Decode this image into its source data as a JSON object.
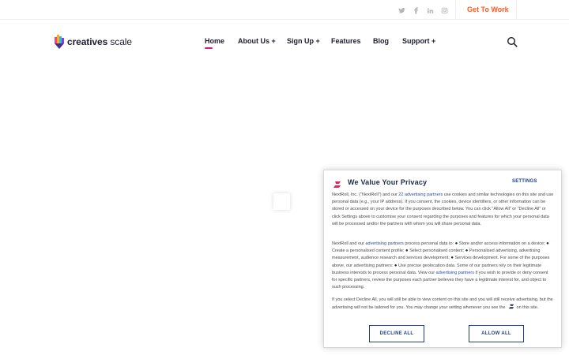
{
  "topbar": {
    "social_icons": [
      "twitter-icon",
      "facebook-icon",
      "linkedin-icon",
      "instagram-icon"
    ],
    "cta_label": "Get To Work"
  },
  "header": {
    "logo_text_bold": "creatives",
    "logo_text_light": "scale",
    "nav": [
      {
        "label": "Home"
      },
      {
        "label": "About Us +"
      },
      {
        "label": "Sign Up +"
      },
      {
        "label": "Features"
      },
      {
        "label": "Blog"
      },
      {
        "label": "Support +"
      }
    ],
    "search_icon": "search-icon"
  },
  "consent": {
    "title": "We Value Your Privacy",
    "settings_label": "SETTINGS",
    "p1_a": "NextRoll, Inc. (\"NextRoll\") and our ",
    "p1_link": "22 advertising partners",
    "p1_b": " use cookies and similar technologies on this site and use personal data (e.g., your IP address). If you consent, the cookies, device identifiers, or other information can be stored or accessed on your device for the purposes described below. You can click \"Allow All\" or \"Decline All\" or click Settings above to customise your consent regarding the purposes and features for which your personal data will be processed and/or the partners with whom you will share personal data.",
    "p2_a": "NextRoll and our ",
    "p2_link": "advertising partners",
    "p2_b": " process personal data to: ",
    "p2_items": [
      "Store and/or access information on a device;",
      "Create a personalised content profile;",
      "Select personalised content;",
      "Personalised advertising, advertising measurement, audience research and services development;",
      "Services development. For some of the purposes above, our advertising partners:",
      "Use precise geolocation data. Some of our partners rely on their legitimate business interests to process personal data. View our"
    ],
    "p2_link2": "advertising partners",
    "p2_c": " if you wish to provide or deny consent for specific partners, review the purposes each partner believes they have a legitimate interest for, and object to such processing.",
    "p3_a": "If you select Decline All, you will still be able to view content on this site and you will still receive advertising, but the advertising will not be tailored for you. You may change your setting whenever you see the",
    "p3_b": "on this site.",
    "decline_label": "DECLINE ALL",
    "allow_label": "ALLOW ALL"
  },
  "colors": {
    "accent_orange": "#ff5a1f",
    "nav_active": "#d6157d",
    "consent_blue": "#1a3d8f"
  }
}
